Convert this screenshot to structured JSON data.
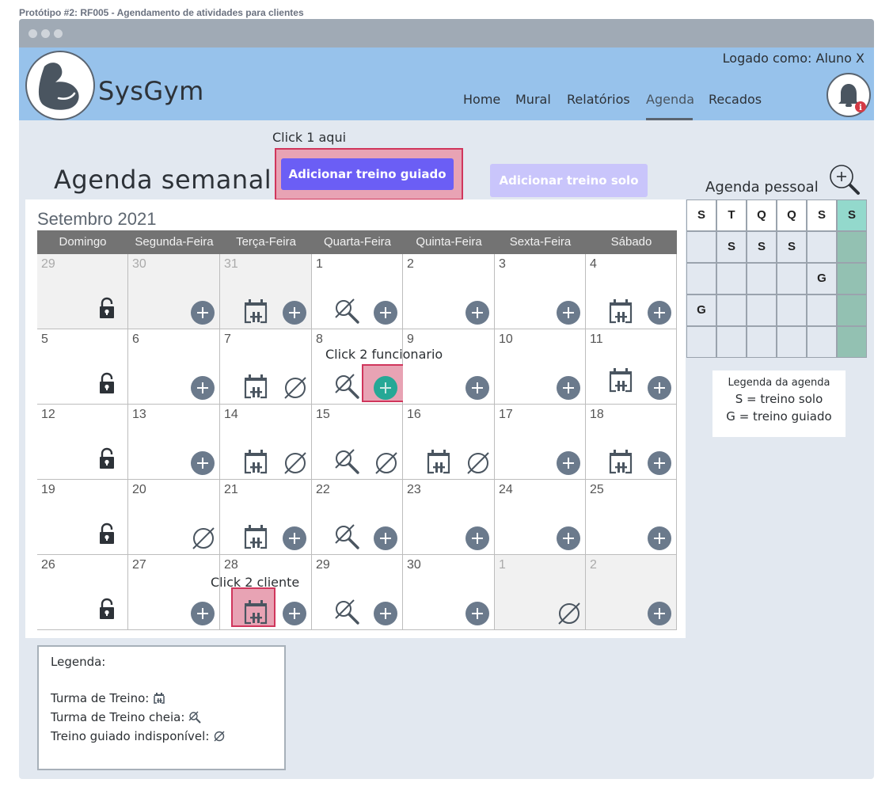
{
  "prototype_title": "Protótipo #2: RF005 - Agendamento de atividades para clientes",
  "header": {
    "brand": "SysGym",
    "logged_in": "Logado como: Aluno X",
    "nav": [
      "Home",
      "Mural",
      "Relatórios",
      "Agenda",
      "Recados"
    ],
    "active_nav": "Agenda",
    "notification_badge": "i"
  },
  "annotations": {
    "click1": "Click 1 aqui",
    "click2_employee": "Click 2 funcionario",
    "click2_client": "Click 2 cliente"
  },
  "page_title": "Agenda semanal",
  "buttons": {
    "guided": "Adicionar treino guiado",
    "solo": "Adicionar treino solo"
  },
  "calendar": {
    "month": "Setembro 2021",
    "weekdays": [
      "Domingo",
      "Segunda-Feira",
      "Terça-Feira",
      "Quarta-Feira",
      "Quinta-Feira",
      "Sexta-Feira",
      "Sábado"
    ],
    "weeks": [
      [
        {
          "n": "29",
          "muted": true,
          "icons": [
            "lock"
          ]
        },
        {
          "n": "30",
          "muted": true,
          "icons": [
            "plus"
          ]
        },
        {
          "n": "31",
          "muted": true,
          "icons": [
            "cal",
            "plus"
          ]
        },
        {
          "n": "1",
          "icons": [
            "full",
            "plus"
          ]
        },
        {
          "n": "2",
          "icons": [
            "plus"
          ]
        },
        {
          "n": "3",
          "icons": [
            "plus"
          ]
        },
        {
          "n": "4",
          "icons": [
            "cal",
            "plus"
          ]
        }
      ],
      [
        {
          "n": "5",
          "icons": [
            "lock"
          ]
        },
        {
          "n": "6",
          "icons": [
            "plus"
          ]
        },
        {
          "n": "7",
          "icons": [
            "cal",
            "none"
          ]
        },
        {
          "n": "8",
          "icons": [
            "full",
            "plus_hl"
          ]
        },
        {
          "n": "9",
          "icons": [
            "plus"
          ]
        },
        {
          "n": "10",
          "icons": [
            "plus"
          ]
        },
        {
          "n": "11",
          "icons": [
            "cal_up",
            "plus"
          ]
        }
      ],
      [
        {
          "n": "12",
          "icons": [
            "lock"
          ]
        },
        {
          "n": "13",
          "icons": [
            "plus"
          ]
        },
        {
          "n": "14",
          "icons": [
            "cal",
            "none"
          ]
        },
        {
          "n": "15",
          "icons": [
            "full",
            "none"
          ]
        },
        {
          "n": "16",
          "icons": [
            "cal",
            "none"
          ]
        },
        {
          "n": "17",
          "icons": [
            "plus"
          ]
        },
        {
          "n": "18",
          "icons": [
            "cal",
            "plus"
          ]
        }
      ],
      [
        {
          "n": "19",
          "icons": [
            "lock"
          ]
        },
        {
          "n": "20",
          "icons": [
            "none"
          ]
        },
        {
          "n": "21",
          "icons": [
            "cal",
            "plus"
          ]
        },
        {
          "n": "22",
          "icons": [
            "full",
            "plus"
          ]
        },
        {
          "n": "23",
          "icons": [
            "plus"
          ]
        },
        {
          "n": "24",
          "icons": [
            "plus"
          ]
        },
        {
          "n": "25",
          "icons": [
            "plus"
          ]
        }
      ],
      [
        {
          "n": "26",
          "icons": [
            "lock"
          ]
        },
        {
          "n": "27",
          "icons": [
            "plus"
          ]
        },
        {
          "n": "28",
          "icons": [
            "cal_hl",
            "plus"
          ]
        },
        {
          "n": "29",
          "icons": [
            "full",
            "plus"
          ]
        },
        {
          "n": "30",
          "icons": [
            "plus"
          ]
        },
        {
          "n": "1",
          "muted": true,
          "icons": [
            "none"
          ]
        },
        {
          "n": "2",
          "muted": true,
          "icons": [
            "plus"
          ]
        }
      ]
    ]
  },
  "personal_agenda": {
    "title": "Agenda pessoal",
    "header": [
      "S",
      "T",
      "Q",
      "Q",
      "S",
      "S"
    ],
    "rows": [
      [
        "",
        "S",
        "S",
        "S",
        "",
        ""
      ],
      [
        "",
        "",
        "",
        "",
        "G",
        ""
      ],
      [
        "G",
        "",
        "",
        "",
        "",
        ""
      ],
      [
        "",
        "",
        "",
        "",
        "",
        ""
      ]
    ]
  },
  "agenda_legend": {
    "title": "Legenda da agenda",
    "solo": "S = treino solo",
    "guided": "G = treino guiado"
  },
  "legend": {
    "title": "Legenda:",
    "class": "Turma de Treino:",
    "full": "Turma de Treino cheia:",
    "unavailable": "Treino guiado indisponível:"
  },
  "colors": {
    "header_bg": "#97c2eb",
    "primary_button": "#6b5ef5",
    "disabled_button": "#c9c5fb",
    "icon": "#6b7a8c",
    "highlight": "#e8a3b4",
    "teal_plus": "#26a896"
  }
}
